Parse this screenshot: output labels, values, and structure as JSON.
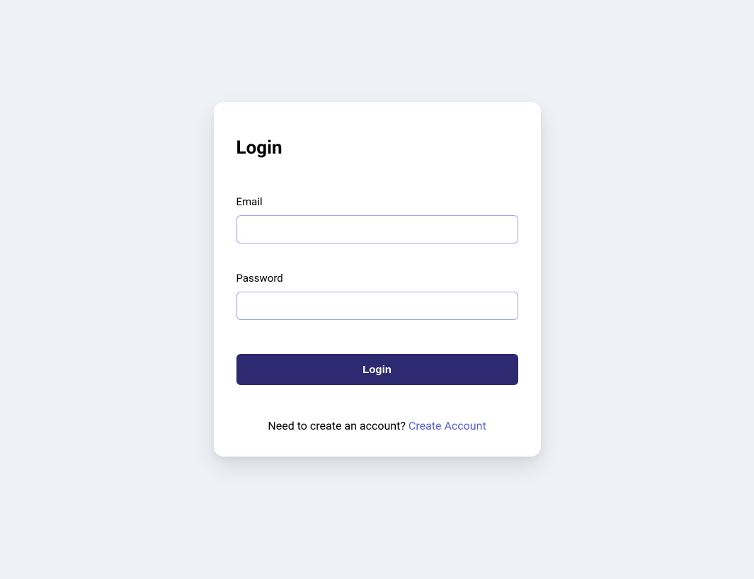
{
  "login": {
    "title": "Login",
    "email_label": "Email",
    "email_value": "",
    "password_label": "Password",
    "password_value": "",
    "submit_label": "Login",
    "footer_prompt": "Need to create an account? ",
    "create_link_label": "Create Account"
  }
}
